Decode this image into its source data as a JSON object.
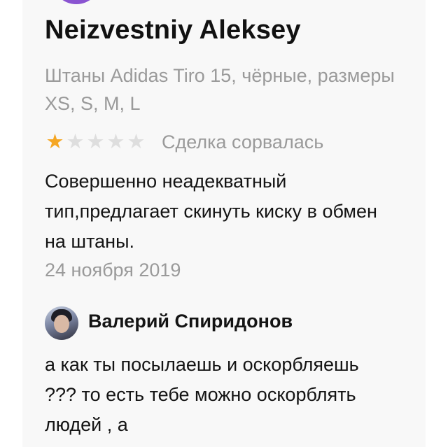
{
  "review": {
    "author": "Neizvestniy Aleksey",
    "product": "Штаны Adidas Tiro 15, чёрные, размеры XS, S, M, L",
    "rating": 1,
    "rating_max": 5,
    "deal_status": "Сделка сорвалась",
    "text": "Совершенно неадекватный тип,предлагает скинуть киску в обмен на штаны.",
    "date": "24 ноября 2019"
  },
  "reply": {
    "author": "Валерий Спиридонов",
    "text": "а как ты посылаешь и оскорбляешь ??? то есть тебе можно оскорблять людей , а "
  },
  "colors": {
    "star_filled": "#f5a623",
    "star_empty": "#dedede",
    "muted_text": "#9a9a9a",
    "avatar_top": "#8a54d1",
    "card_background": "#f8f8f8"
  },
  "icons": {
    "star": "star-icon"
  }
}
